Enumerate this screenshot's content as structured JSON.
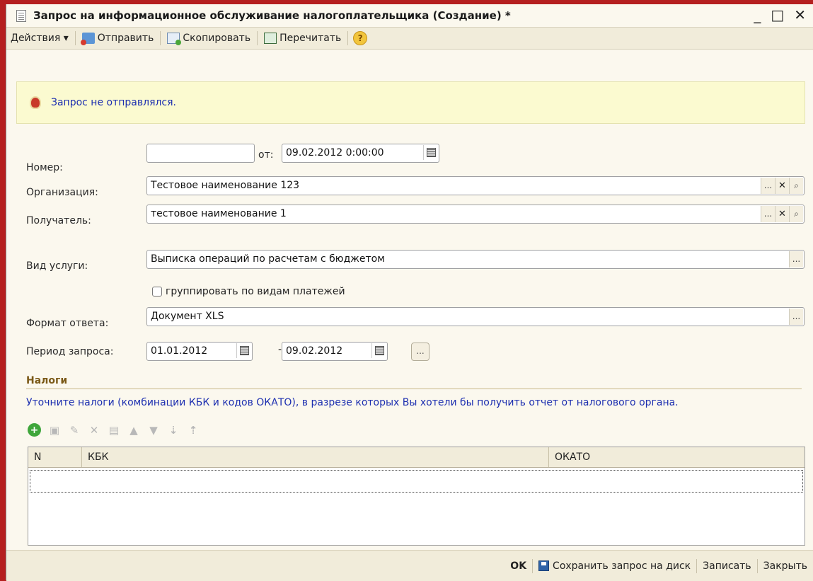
{
  "window": {
    "title": "Запрос на информационное обслуживание налогоплательщика (Создание) *",
    "min_glyph": "_",
    "max_glyph": "□",
    "close_glyph": "✕"
  },
  "toolbar": {
    "actions_label": "Действия ▾",
    "send_label": "Отправить",
    "copy_label": "Скопировать",
    "reread_label": "Перечитать",
    "help_glyph": "?"
  },
  "status": {
    "text": "Запрос не отправлялся."
  },
  "form": {
    "number_label": "Номер:",
    "number_value": "",
    "from_label": "от:",
    "date_value": "09.02.2012  0:00:00",
    "organization_label": "Организация:",
    "organization_value": "Тестовое наименование 123",
    "recipient_label": "Получатель:",
    "recipient_value": "тестовое наименование  1",
    "service_label": "Вид услуги:",
    "service_value": "Выписка операций по расчетам с бюджетом",
    "group_checkbox_label": "группировать по видам платежей",
    "group_checkbox_checked": false,
    "format_label": "Формат ответа:",
    "format_value": "Документ XLS",
    "period_label": "Период запроса:",
    "period_from": "01.01.2012",
    "period_dash": "-",
    "period_to": "09.02.2012",
    "ellipsis": "...",
    "clear_glyph": "✕",
    "search_glyph": "⌕"
  },
  "taxes": {
    "section_title": "Налоги",
    "hint": "Уточните налоги (комбинации КБК и кодов ОКАТО), в разрезе которых Вы хотели бы получить отчет от налогового органа.",
    "columns": [
      "N",
      "КБК",
      "ОКАТО"
    ]
  },
  "bottom": {
    "ok_label": "OK",
    "save_disk_label": "Сохранить запрос на диск",
    "write_label": "Записать",
    "close_label": "Закрыть"
  }
}
